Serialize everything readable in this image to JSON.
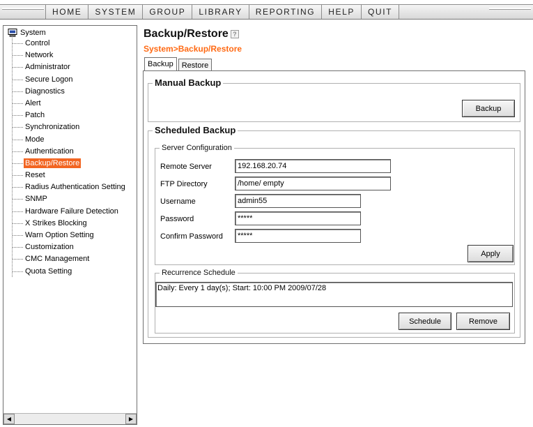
{
  "menu": [
    "HOME",
    "SYSTEM",
    "GROUP",
    "LIBRARY",
    "REPORTING",
    "HELP",
    "QUIT"
  ],
  "tree": {
    "root": "System",
    "items": [
      "Control",
      "Network",
      "Administrator",
      "Secure Logon",
      "Diagnostics",
      "Alert",
      "Patch",
      "Synchronization",
      "Mode",
      "Authentication",
      "Backup/Restore",
      "Reset",
      "Radius Authentication Setting",
      "SNMP",
      "Hardware Failure Detection",
      "X Strikes Blocking",
      "Warn Option Setting",
      "Customization",
      "CMC Management",
      "Quota Setting"
    ],
    "selected": "Backup/Restore"
  },
  "page": {
    "title": "Backup/Restore",
    "help_icon": "?",
    "breadcrumb": "System>Backup/Restore"
  },
  "tabs": [
    "Backup",
    "Restore"
  ],
  "manual_backup": {
    "legend": "Manual Backup",
    "button": "Backup"
  },
  "scheduled_backup": {
    "legend": "Scheduled Backup",
    "server_config": {
      "legend": "Server Configuration",
      "remote_server_label": "Remote Server",
      "remote_server_value": "192.168.20.74",
      "ftp_dir_label": "FTP Directory",
      "ftp_dir_value": "/home/ empty",
      "username_label": "Username",
      "username_value": "admin55",
      "password_label": "Password",
      "password_value": "*****",
      "confirm_label": "Confirm Password",
      "confirm_value": "*****",
      "apply_button": "Apply"
    },
    "recurrence": {
      "legend": "Recurrence Schedule",
      "text": "Daily: Every 1 day(s); Start: 10:00 PM 2009/07/28",
      "schedule_button": "Schedule",
      "remove_button": "Remove"
    }
  },
  "scroll": {
    "left": "◀",
    "right": "▶"
  },
  "colors": {
    "selection": "#f26522",
    "breadcrumb": "#ff6a14"
  }
}
